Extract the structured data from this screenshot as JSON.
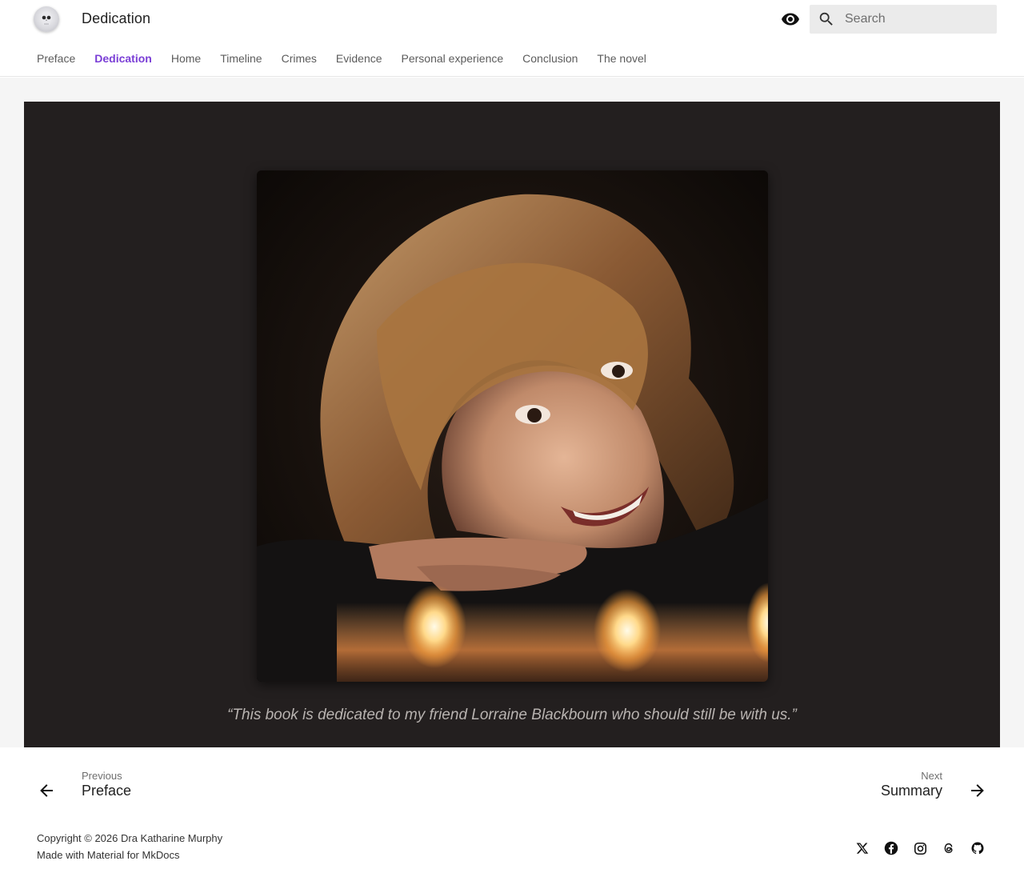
{
  "header": {
    "title": "Dedication",
    "logo_icon": "skull-icon",
    "palette_toggle_icon": "eye-icon",
    "search": {
      "placeholder": "Search",
      "icon": "search-icon"
    }
  },
  "tabs": [
    {
      "label": "Preface",
      "active": false
    },
    {
      "label": "Dedication",
      "active": true
    },
    {
      "label": "Home",
      "active": false
    },
    {
      "label": "Timeline",
      "active": false
    },
    {
      "label": "Crimes",
      "active": false
    },
    {
      "label": "Evidence",
      "active": false
    },
    {
      "label": "Personal experience",
      "active": false
    },
    {
      "label": "Conclusion",
      "active": false
    },
    {
      "label": "The novel",
      "active": false
    }
  ],
  "main": {
    "quote": "“This book is dedicated to my friend Lorraine Blackbourn who should still be with us.”"
  },
  "footer_nav": {
    "previous": {
      "caption": "Previous",
      "title": "Preface"
    },
    "next": {
      "caption": "Next",
      "title": "Summary"
    }
  },
  "footer": {
    "copyright": "Copyright © 2026 Dra Katharine Murphy",
    "made_with": "Made with Material for MkDocs",
    "social_icons": [
      "x-icon",
      "facebook-icon",
      "instagram-icon",
      "threads-icon",
      "github-icon"
    ]
  },
  "colors": {
    "accent": "#7a3ed6",
    "dark_panel": "#231f1f",
    "quote_text": "#b8b3b0"
  }
}
